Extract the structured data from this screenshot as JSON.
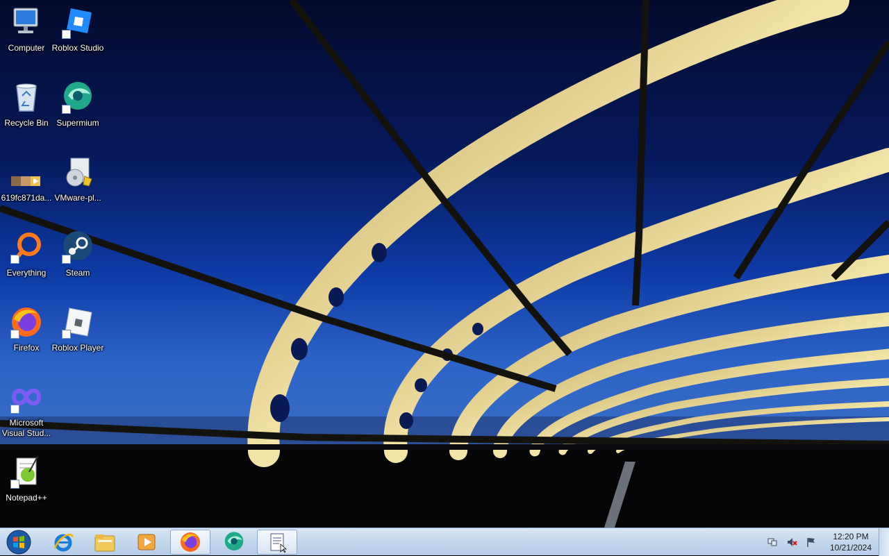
{
  "desktop": {
    "icons": [
      {
        "label": "Computer"
      },
      {
        "label": "Roblox Studio"
      },
      {
        "label": "Recycle Bin"
      },
      {
        "label": "Supermium"
      },
      {
        "label": "619fc871da..."
      },
      {
        "label": "VMware-pl..."
      },
      {
        "label": "Everything"
      },
      {
        "label": "Steam"
      },
      {
        "label": "Firefox"
      },
      {
        "label": "Roblox Player"
      },
      {
        "label": "Microsoft Visual Stud..."
      },
      {
        "label": "Notepad++"
      }
    ]
  },
  "taskbar": {
    "start_icon": "windows-orb-icon",
    "pinned": [
      {
        "name": "internet-explorer-icon"
      },
      {
        "name": "file-explorer-icon"
      },
      {
        "name": "media-player-icon"
      },
      {
        "name": "firefox-icon"
      },
      {
        "name": "supermium-icon"
      },
      {
        "name": "notepad-document-icon"
      }
    ],
    "tray": {
      "time": "12:20 PM",
      "date": "10/21/2024"
    }
  }
}
